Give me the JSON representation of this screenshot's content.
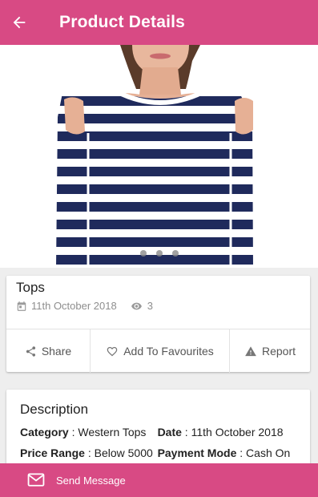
{
  "appbar": {
    "title": "Product Details"
  },
  "gallery": {
    "dot_count": 3
  },
  "product": {
    "title": "Tops",
    "date": "11th October 2018",
    "views": "3"
  },
  "actions": {
    "share": "Share",
    "favourite": "Add To Favourites",
    "report": "Report"
  },
  "description": {
    "heading": "Description",
    "rows": [
      [
        {
          "label": "Category",
          "value": " : Western Tops"
        },
        {
          "label": "Date",
          "value": " : 11th October 2018"
        }
      ],
      [
        {
          "label": "Price Range",
          "value": " : Below 5000"
        },
        {
          "label": "Payment Mode",
          "value": " : Cash On Delivery & Online"
        }
      ]
    ]
  },
  "bottom": {
    "send_label": "Send Message"
  },
  "colors": {
    "accent": "#d84a84",
    "stripe": "#1f2a5c"
  }
}
